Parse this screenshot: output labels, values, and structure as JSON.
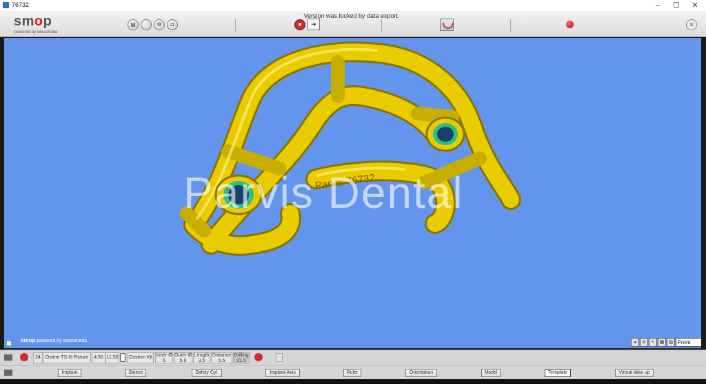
{
  "window": {
    "title": "76732",
    "controls": [
      "–",
      "☐",
      "✕"
    ]
  },
  "toolbar": {
    "logo_main_prefix": "sm",
    "logo_main_o": "o",
    "logo_main_suffix": "p",
    "logo_sub": "powered by swissmeda",
    "status_message": "Version was locked by data export.",
    "accent_color": "#d22a2a"
  },
  "viewport": {
    "background_color": "#6495ed",
    "model_color": "#e8cc00",
    "sleeve_color": "#2bbf8a",
    "engraving": "Parvis 76732",
    "watermark": "Parvis Dental",
    "brand_prefix": "smop",
    "brand_suffix": " powered by swissmeda",
    "view_select": "Front"
  },
  "infobar": {
    "position": "24",
    "implant": "Ostem TS III Fixture",
    "diameter": "4.50",
    "length": "11.50",
    "kit": "Osstem Kit",
    "inner_label": "Inner Ø",
    "inner_value": "5",
    "outer_label": "Outer Ø",
    "outer_value": "5.9",
    "length_label": "Length",
    "length_value": "3.5",
    "distance_label": "Distance",
    "distance_value": "5.5",
    "drilling_label": "Drilling",
    "drilling_value": "21.5"
  },
  "tabs": [
    "Implant",
    "Sleeve",
    "Safety Cyl.",
    "Implant Axis",
    "Ruler",
    "Orientation",
    "Model",
    "Template",
    "Virtual Wax up"
  ],
  "active_tab": "Template"
}
